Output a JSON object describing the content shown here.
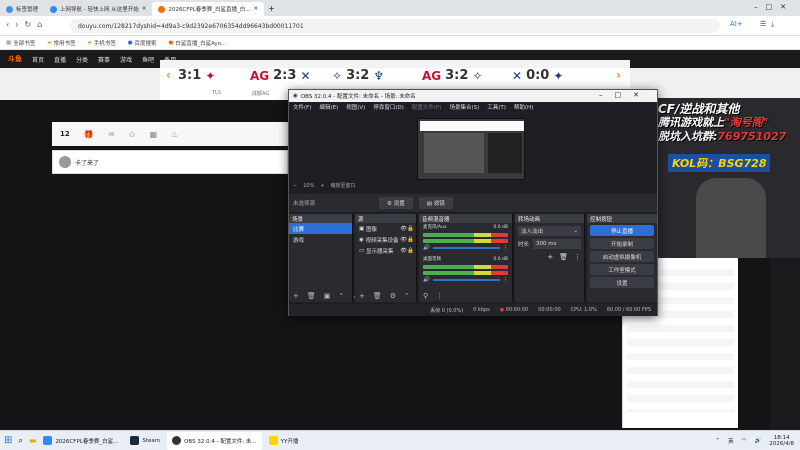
{
  "browser": {
    "tabs": [
      {
        "label": "标签管理",
        "active": false
      },
      {
        "label": "上网导航 - 轻快上网 从这里开始",
        "active": false
      },
      {
        "label": "2026CFPL春季赛_白鲨直播_白...",
        "active": true
      }
    ],
    "url": "douyu.com/128217dyshid=4d9a3-c9d2392e6706354dd96643bd00011701",
    "bookmarks": [
      "全部书签",
      "常用书签",
      "手机书签",
      "百度搜索",
      "白鲨直播_白鲨Ayo..."
    ]
  },
  "site": {
    "nav": [
      "首页",
      "直播",
      "分类",
      "赛事",
      "游戏",
      "鱼吧",
      "备用"
    ],
    "matches": [
      {
        "score": "3:1",
        "team": "TLS"
      },
      {
        "score": "2:3",
        "team": "成都AG"
      },
      {
        "score": "3:2",
        "team": ""
      },
      {
        "score": "3:2",
        "team": ""
      },
      {
        "score": "0:0",
        "team": ""
      }
    ],
    "room_count": "12",
    "chat_user": "卡了来了"
  },
  "obs": {
    "title": "OBS 32.0.4 - 配置文件: 未命名 - 场景: 未命名",
    "menu": [
      "文件(F)",
      "编辑(E)",
      "视图(V)",
      "停靠窗口(D)",
      "配置文件(P)",
      "场景集合(S)",
      "工具(T)",
      "帮助(H)"
    ],
    "zoom": "10%",
    "scale_label": "缩放至窗口",
    "no_source": "未选择源",
    "properties_btn": "设置",
    "filters_btn": "滤镜",
    "scenes_header": "场景",
    "scenes": [
      "比赛",
      "游戏"
    ],
    "sources_header": "源",
    "sources": [
      "图像",
      "视频采集设备",
      "显示器采集"
    ],
    "mixer_header": "音频混音器",
    "mixer": [
      {
        "name": "麦克风/Aux",
        "db": "0.0 dB"
      },
      {
        "name": "桌面音频",
        "db": "0.0 dB"
      }
    ],
    "transitions_header": "转场动画",
    "transition_type": "淡入淡出",
    "duration_label": "时长",
    "duration": "300 ms",
    "controls_header": "控制按钮",
    "controls": [
      "停止直播",
      "开始录制",
      "启动虚拟摄像机",
      "工作室模式",
      "设置"
    ],
    "status": {
      "dropped": "丢帧 0 (0.0%)",
      "kbps": "0 kbps",
      "live": "00:00:00",
      "rec": "00:00:00",
      "cpu": "CPU: 1.0%",
      "fps": "60.00 / 60.00 FPS"
    }
  },
  "overlay": {
    "line1": "CF/逆战和其他",
    "line2": "腾讯游戏就上",
    "brand": "\"淘号阁\"",
    "line3": "脱坑入坑群:",
    "group": "769751027",
    "kol": "KOL码：BSG728"
  },
  "taskbar": {
    "items": [
      "2026CFPL春季赛_白鲨...",
      "Steam",
      "OBS 32.0.4 - 配置文件: 未...",
      "YY开播"
    ],
    "time": "18:14",
    "date": "2026/4/8",
    "ime": "英"
  },
  "colors": {
    "accent": "#2c6fd6",
    "live_red": "#e53935",
    "overlay_yellow": "#ffd400"
  }
}
